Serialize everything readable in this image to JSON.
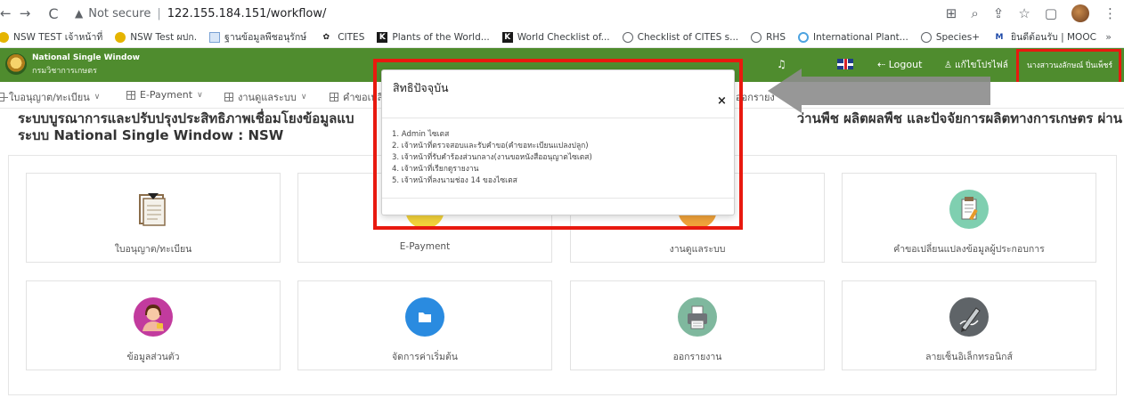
{
  "browser": {
    "nav": {
      "back": "←",
      "forward": "→",
      "reload": "C"
    },
    "security_label": "Not secure",
    "url": "122.155.184.151/workflow/",
    "bookmarks": [
      {
        "label": "NSW TEST เจ้าหน้าที่",
        "icon": "bookmark-icon-nsw"
      },
      {
        "label": "NSW Test ผปก.",
        "icon": "bookmark-icon-nsw"
      },
      {
        "label": "ฐานข้อมูลพืชอนุรักษ์",
        "icon": "bookmark-icon-plant"
      },
      {
        "label": "CITES",
        "icon": "bookmark-icon-cites"
      },
      {
        "label": "Plants of the World...",
        "icon": "bookmark-icon-k"
      },
      {
        "label": "World Checklist of...",
        "icon": "bookmark-icon-k"
      },
      {
        "label": "Checklist of CITES s...",
        "icon": "bookmark-icon-globe"
      },
      {
        "label": "RHS",
        "icon": "bookmark-icon-globe"
      },
      {
        "label": "International Plant...",
        "icon": "bookmark-icon-ring"
      },
      {
        "label": "Species+",
        "icon": "bookmark-icon-globe"
      },
      {
        "label": "ยินดีต้อนรับ | MOOC",
        "icon": "bookmark-icon-mooc"
      }
    ],
    "bookmarks_more": "»"
  },
  "header": {
    "brand_title": "National Single Window",
    "brand_sub": "กรมวิชาการเกษตร",
    "logout": "Logout",
    "edit_profile": "แก้ไขโปรไฟล์",
    "user_name": "นางสาวนงลักษณ์ ปิ่นเพ็ชร์",
    "brand_color": "#4f8c2e"
  },
  "menu": {
    "items": [
      {
        "label": "ใบอนุญาต/ทะเบียน",
        "chevron": "∨"
      },
      {
        "label": "E-Payment",
        "chevron": "∨"
      },
      {
        "label": "งานดูแลระบบ",
        "chevron": "∨"
      },
      {
        "label": "คำขอเปลี่"
      },
      {
        "label": "ออกรายง"
      }
    ]
  },
  "page": {
    "title_line1": "ระบบบูรณาการและปรับปรุงประสิทธิภาพเชื่อมโยงข้อมูลแบ",
    "title_line1_right": "ว่านพืช ผลิตผลพืช และปัจจัยการผลิตทางการเกษตร ผ่าน",
    "title_line2": "ระบบ National Single Window : NSW"
  },
  "cards": [
    {
      "label": "ใบอนุญาต/ทะเบียน",
      "icon": "document-icon"
    },
    {
      "label": "E-Payment",
      "icon": "payment-icon"
    },
    {
      "label": "งานดูแลระบบ",
      "icon": "admin-icon"
    },
    {
      "label": "คำขอเปลี่ยนแปลงข้อมูลผู้ประกอบการ",
      "icon": "change-request-icon"
    },
    {
      "label": "ข้อมูลส่วนตัว",
      "icon": "user-profile-icon"
    },
    {
      "label": "จัดการค่าเริ่มต้น",
      "icon": "folder-icon"
    },
    {
      "label": "ออกรายงาน",
      "icon": "printer-icon"
    },
    {
      "label": "ลายเซ็นอิเล็กทรอนิกส์",
      "icon": "signature-icon"
    }
  ],
  "modal": {
    "title": "สิทธิปัจจุบัน",
    "close": "×",
    "permissions": [
      "1. Admin ไซเตส",
      "2. เจ้าหน้าที่ตรวจสอบและรับคำขอ(คำขอทะเบียนแปลงปลูก)",
      "3. เจ้าหน้าที่รับคำร้องส่วนกลาง(งานขอหนังสืออนุญาตไซเตส)",
      "4. เจ้าหน้าที่เรียกดูรายงาน",
      "5. เจ้าหน้าที่ลงนามช่อง 14 ของไซเตส"
    ]
  },
  "annotation_color": "#e8190f"
}
